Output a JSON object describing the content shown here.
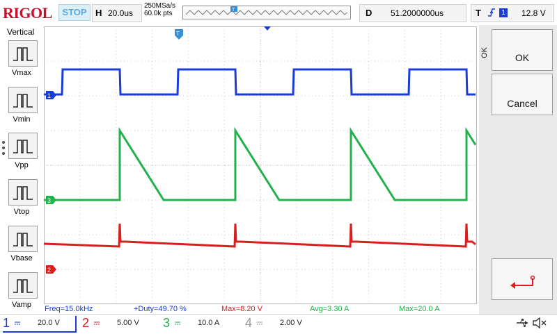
{
  "brand": "RIGOL",
  "run_status": "STOP",
  "horizontal": {
    "key": "H",
    "timebase": "20.0us"
  },
  "acquisition": {
    "sample_rate": "250MSa/s",
    "points": "60.0k pts"
  },
  "trigger_bar_marker": "T",
  "delay": {
    "key": "D",
    "value": "51.2000000us"
  },
  "trigger": {
    "key": "T",
    "source": "1",
    "level": "12.8 V"
  },
  "left_menu": {
    "title": "Vertical",
    "items": [
      {
        "label": "Vmax",
        "icon": "pulse-max-icon"
      },
      {
        "label": "Vmin",
        "icon": "pulse-min-icon"
      },
      {
        "label": "Vpp",
        "icon": "pulse-pp-icon"
      },
      {
        "label": "Vtop",
        "icon": "pulse-top-icon"
      },
      {
        "label": "Vbase",
        "icon": "pulse-base-icon"
      },
      {
        "label": "Vamp",
        "icon": "pulse-amp-icon"
      }
    ]
  },
  "screen": {
    "trigger_pos_marker": "T",
    "channel_markers": [
      {
        "label": "1",
        "color": "#1a3bd6"
      },
      {
        "label": "3",
        "color": "#22b14c"
      },
      {
        "label": "2",
        "color": "#d81e1e"
      }
    ]
  },
  "right_panel": {
    "side_label": "OK",
    "ok_label": "OK",
    "cancel_label": "Cancel",
    "enter_icon": "enter-arrow-icon"
  },
  "measurements": [
    {
      "text": "Freq=15.0kHz",
      "color": "#1a3bd6"
    },
    {
      "text": "+Duty=49.70 %",
      "color": "#1a3bd6"
    },
    {
      "text": "Max=8.20 V",
      "color": "#d81e1e"
    },
    {
      "text": "Avg=3.30 A",
      "color": "#22b14c"
    },
    {
      "text": "Max=20.0 A",
      "color": "#22b14c"
    }
  ],
  "channels": [
    {
      "num": "1",
      "scale": "20.0 V",
      "color": "#1a3bd6"
    },
    {
      "num": "2",
      "scale": "5.00 V",
      "color": "#d81e1e"
    },
    {
      "num": "3",
      "scale": "10.0 A",
      "color": "#22b14c"
    },
    {
      "num": "4",
      "scale": "2.00 V",
      "color": "#9a9a9a"
    }
  ],
  "status_icons": [
    "usb-icon",
    "speaker-muted-icon"
  ]
}
